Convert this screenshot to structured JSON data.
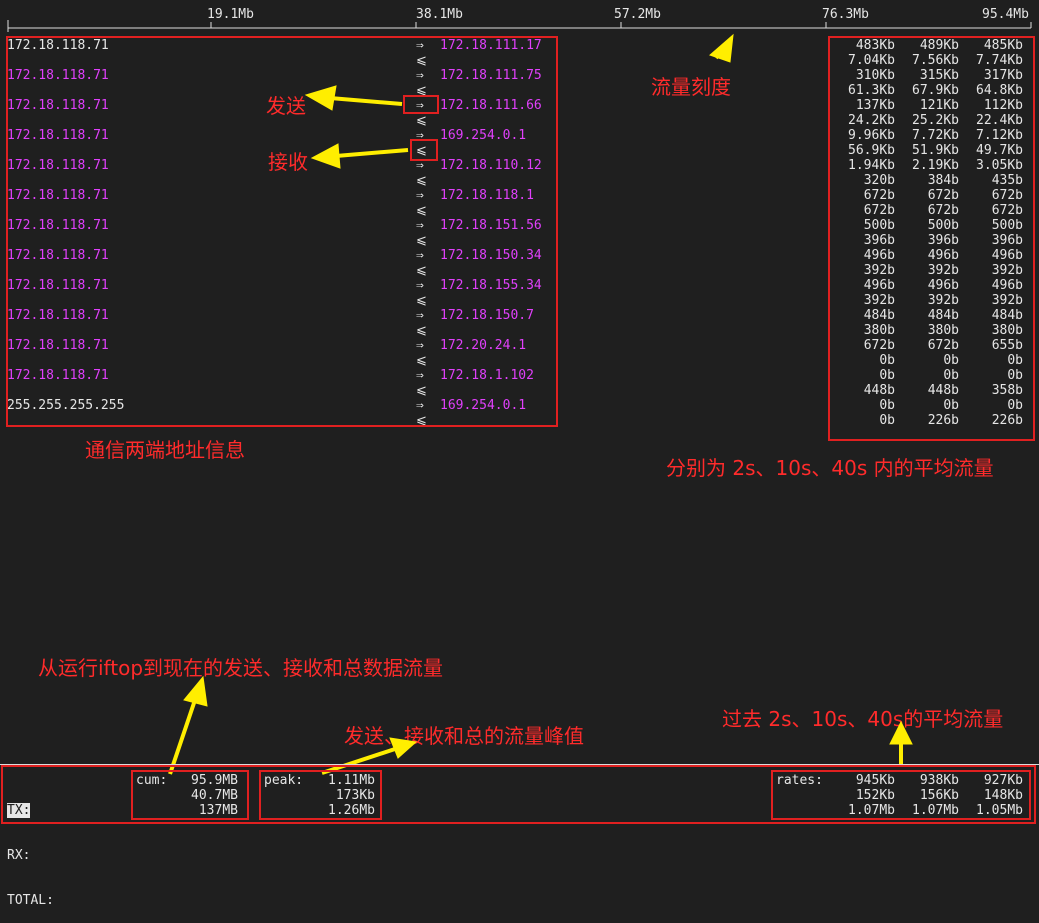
{
  "scale": {
    "ticks": [
      "19.1Mb",
      "38.1Mb",
      "57.2Mb",
      "76.3Mb",
      "95.4Mb"
    ]
  },
  "connections": [
    {
      "src": "172.18.118.71",
      "dst": "172.18.111.17",
      "src_color": "#e6e6e6",
      "send": "⇒",
      "recv": "⩽"
    },
    {
      "src": "172.18.118.71",
      "dst": "172.18.111.75",
      "src_color": "#e040fb",
      "send": "⇒",
      "recv": "⩽"
    },
    {
      "src": "172.18.118.71",
      "dst": "172.18.111.66",
      "src_color": "#e040fb",
      "send": "⇒",
      "recv": "⩽"
    },
    {
      "src": "172.18.118.71",
      "dst": "169.254.0.1",
      "src_color": "#e040fb",
      "send": "⇒",
      "recv": "⩽"
    },
    {
      "src": "172.18.118.71",
      "dst": "172.18.110.12",
      "src_color": "#e040fb",
      "send": "⇒",
      "recv": "⩽"
    },
    {
      "src": "172.18.118.71",
      "dst": "172.18.118.1",
      "src_color": "#e040fb",
      "send": "⇒",
      "recv": "⩽"
    },
    {
      "src": "172.18.118.71",
      "dst": "172.18.151.56",
      "src_color": "#e040fb",
      "send": "⇒",
      "recv": "⩽"
    },
    {
      "src": "172.18.118.71",
      "dst": "172.18.150.34",
      "src_color": "#e040fb",
      "send": "⇒",
      "recv": "⩽"
    },
    {
      "src": "172.18.118.71",
      "dst": "172.18.155.34",
      "src_color": "#e040fb",
      "send": "⇒",
      "recv": "⩽"
    },
    {
      "src": "172.18.118.71",
      "dst": "172.18.150.7",
      "src_color": "#e040fb",
      "send": "⇒",
      "recv": "⩽"
    },
    {
      "src": "172.18.118.71",
      "dst": "172.20.24.1",
      "src_color": "#e040fb",
      "send": "⇒",
      "recv": "⩽"
    },
    {
      "src": "172.18.118.71",
      "dst": "172.18.1.102",
      "src_color": "#e040fb",
      "send": "⇒",
      "recv": "⩽"
    },
    {
      "src": "255.255.255.255",
      "dst": "169.254.0.1",
      "src_color": "#e6e6e6",
      "send": "⇒",
      "recv": "⩽"
    }
  ],
  "rates": [
    [
      "483Kb",
      "489Kb",
      "485Kb"
    ],
    [
      "7.04Kb",
      "7.56Kb",
      "7.74Kb"
    ],
    [
      "310Kb",
      "315Kb",
      "317Kb"
    ],
    [
      "61.3Kb",
      "67.9Kb",
      "64.8Kb"
    ],
    [
      "137Kb",
      "121Kb",
      "112Kb"
    ],
    [
      "24.2Kb",
      "25.2Kb",
      "22.4Kb"
    ],
    [
      "9.96Kb",
      "7.72Kb",
      "7.12Kb"
    ],
    [
      "56.9Kb",
      "51.9Kb",
      "49.7Kb"
    ],
    [
      "1.94Kb",
      "2.19Kb",
      "3.05Kb"
    ],
    [
      "320b",
      "384b",
      "435b"
    ],
    [
      "672b",
      "672b",
      "672b"
    ],
    [
      "672b",
      "672b",
      "672b"
    ],
    [
      "500b",
      "500b",
      "500b"
    ],
    [
      "396b",
      "396b",
      "396b"
    ],
    [
      "496b",
      "496b",
      "496b"
    ],
    [
      "392b",
      "392b",
      "392b"
    ],
    [
      "496b",
      "496b",
      "496b"
    ],
    [
      "392b",
      "392b",
      "392b"
    ],
    [
      "484b",
      "484b",
      "484b"
    ],
    [
      "380b",
      "380b",
      "380b"
    ],
    [
      "672b",
      "672b",
      "655b"
    ],
    [
      "0b",
      "0b",
      "0b"
    ],
    [
      "0b",
      "0b",
      "0b"
    ],
    [
      "448b",
      "448b",
      "358b"
    ],
    [
      "0b",
      "0b",
      "0b"
    ],
    [
      "0b",
      "226b",
      "226b"
    ]
  ],
  "annotations": {
    "send": "发送",
    "recv": "接收",
    "scale": "流量刻度",
    "addresses": "通信两端地址信息",
    "averages": "分别为 2s、10s、40s 内的平均流量",
    "cumulative": "从运行iftop到现在的发送、接收和总数据流量",
    "peak": "发送、接收和总的流量峰值",
    "past_avg": "过去 2s、10s、40s的平均流量"
  },
  "footer": {
    "labels": [
      "TX:",
      "RX:",
      "TOTAL:"
    ],
    "cum_label": "cum:",
    "cum": [
      "95.9MB",
      "40.7MB",
      "137MB"
    ],
    "peak_label": "peak:",
    "peak": [
      "1.11Mb",
      "173Kb",
      "1.26Mb"
    ],
    "rates_label": "rates:",
    "rates": [
      [
        "945Kb",
        "938Kb",
        "927Kb"
      ],
      [
        "152Kb",
        "156Kb",
        "148Kb"
      ],
      [
        "1.07Mb",
        "1.07Mb",
        "1.05Mb"
      ]
    ]
  },
  "colors": {
    "annotation": "#ff2b2b",
    "arrow": "#ffee00",
    "host_highlight": "#e040fb"
  }
}
